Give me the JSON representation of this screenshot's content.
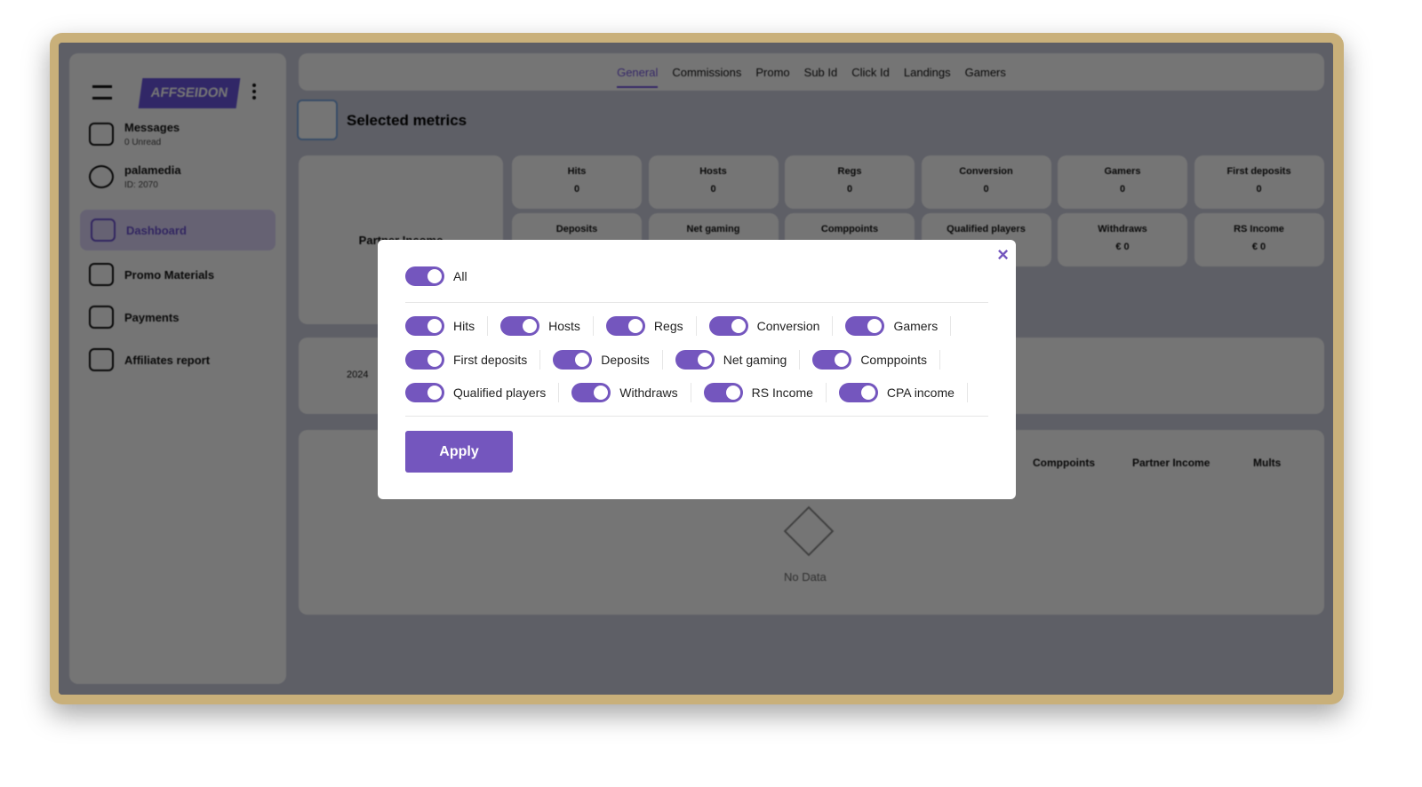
{
  "sidebar": {
    "logo": "AFFSEIDON",
    "items": [
      {
        "label": "Messages",
        "sub": "0 Unread"
      },
      {
        "label": "palamedia",
        "sub": "ID: 2070"
      },
      {
        "label": "Dashboard"
      },
      {
        "label": "Promo Materials"
      },
      {
        "label": "Payments"
      },
      {
        "label": "Affiliates report"
      }
    ]
  },
  "tabs": [
    "General",
    "Commissions",
    "Promo",
    "Sub Id",
    "Click Id",
    "Landings",
    "Gamers"
  ],
  "selected_metrics": "Selected metrics",
  "partner_income": "Partner Income",
  "metrics_row1": [
    {
      "label": "Hits",
      "value": "0"
    },
    {
      "label": "Hosts",
      "value": "0"
    },
    {
      "label": "Regs",
      "value": "0"
    },
    {
      "label": "Conversion",
      "value": "0"
    },
    {
      "label": "Gamers",
      "value": "0"
    },
    {
      "label": "First deposits",
      "value": "0"
    }
  ],
  "metrics_row2": [
    {
      "label": "Deposits",
      "value": ""
    },
    {
      "label": "Net gaming",
      "value": ""
    },
    {
      "label": "Comppoints",
      "value": ""
    },
    {
      "label": "Qualified players",
      "value": ""
    },
    {
      "label": "Withdraws",
      "value": "€ 0"
    },
    {
      "label": "RS Income",
      "value": "€ 0"
    }
  ],
  "date_prefix": "2024",
  "table_headers": [
    "Comppoints",
    "Partner Income",
    "Mults"
  ],
  "no_data": "No Data",
  "modal": {
    "all": "All",
    "close": "×",
    "apply": "Apply",
    "rows": [
      [
        "Hits",
        "Hosts",
        "Regs",
        "Conversion",
        "Gamers"
      ],
      [
        "First deposits",
        "Deposits",
        "Net gaming",
        "Comppoints"
      ],
      [
        "Qualified players",
        "Withdraws",
        "RS Income",
        "CPA income"
      ]
    ],
    "all_on": true
  },
  "colors": {
    "accent": "#7456be",
    "frame": "#c9b07a"
  }
}
